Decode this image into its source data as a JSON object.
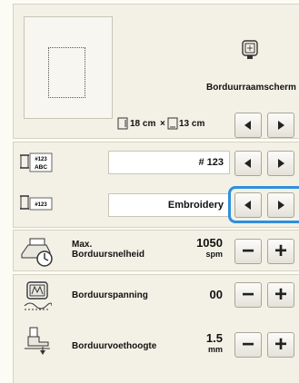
{
  "frame_section": {
    "frame_name": "Borduurraamscherm",
    "width_value": "18 cm",
    "times": "×",
    "height_value": "13 cm"
  },
  "id_row": {
    "value": "# 123",
    "icon_text_top": "#123",
    "icon_text_bottom": "ABC"
  },
  "display_row": {
    "value": "Embroidery",
    "icon_text": "#123",
    "highlighted": true,
    "highlight_color": "#2f8fdc"
  },
  "speed_row": {
    "label_line1": "Max.",
    "label_line2": "Borduursnelheid",
    "value": "1050",
    "unit": "spm"
  },
  "tension_row": {
    "label": "Borduurspanning",
    "value": "00"
  },
  "foot_height_row": {
    "label": "Borduurvoethoogte",
    "value": "1.5",
    "unit": "mm"
  },
  "buttons": {
    "minus": "−",
    "plus": "+"
  }
}
